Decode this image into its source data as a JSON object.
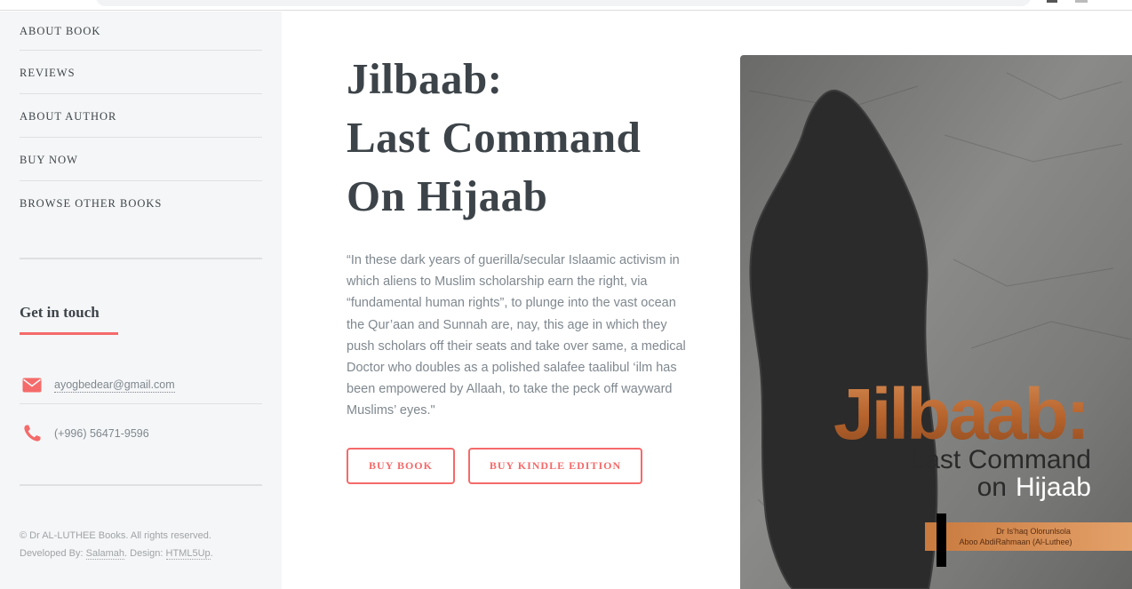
{
  "sidebar": {
    "nav": [
      "ABOUT BOOK",
      "REVIEWS",
      "ABOUT AUTHOR",
      "BUY NOW",
      "BROWSE OTHER BOOKS"
    ],
    "contact_heading": "Get in touch",
    "email": "ayogbedear@gmail.com",
    "phone": "(+996) 56471-9596",
    "footer": {
      "copyright": "© Dr AL-LUTHEE Books. All rights reserved.",
      "developed_by_label": "Developed By:",
      "developer": "Salamah",
      "design_label": "Design:",
      "designer": "HTML5Up"
    }
  },
  "main": {
    "title_lines": [
      "Jilbaab:",
      "Last Command",
      "On Hijaab"
    ],
    "quote": "“In these dark years of guerilla/secular Islaamic activism in which aliens to Muslim scholarship earn the right, via “fundamental human rights”, to plunge into the vast ocean the Qur’aan and Sunnah are, nay, this age in which they push scholars off their seats and take over same, a medical Doctor who doubles as a polished salafee taalibul ‘ilm has been empowered by Allaah, to take the peck off wayward Muslims’ eyes.\"",
    "buy_book_label": "BUY BOOK",
    "buy_kindle_label": "BUY KINDLE EDITION"
  },
  "cover": {
    "title": "Jilbaab:",
    "subtitle_line1": "Last Command",
    "subtitle_on": "on",
    "subtitle_hijaab": "Hijaab",
    "author_line1": "Dr Is'haq Olorunlsola",
    "author_line2": "Aboo AbdiRahmaan (Al-Luthee)"
  },
  "colors": {
    "accent": "#f56a6a",
    "text_dark": "#3d4449",
    "text_muted": "#7f888f",
    "sidebar_bg": "#f5f6f7",
    "cover_copper": "#b8652e"
  },
  "icons": {
    "email": "envelope-icon",
    "phone": "phone-icon"
  }
}
